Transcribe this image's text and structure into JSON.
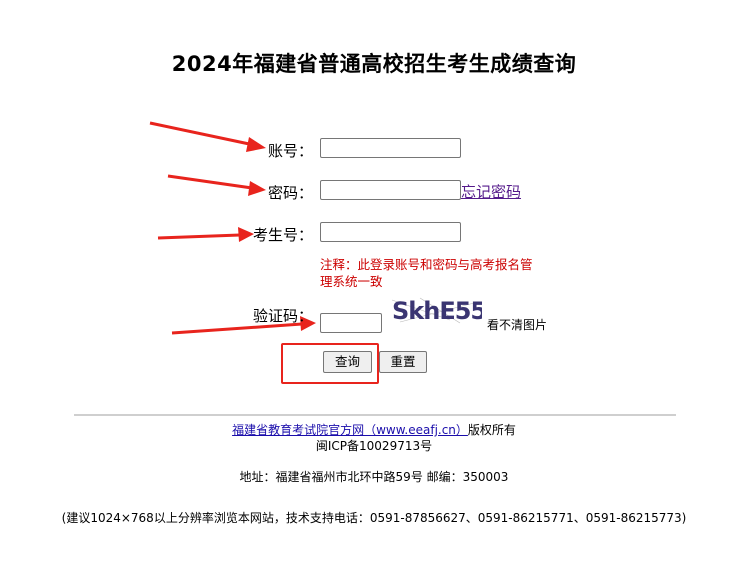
{
  "page": {
    "title": "2024年福建省普通高校招生考生成绩查询"
  },
  "form": {
    "account_label": "账号：",
    "account_value": "",
    "password_label": "密码：",
    "password_value": "",
    "forgot_link": "忘记密码",
    "exam_no_label": "考生号：",
    "exam_no_value": "",
    "note": "注释：此登录账号和密码与高考报名管理系统一致",
    "captcha_label": "验证码：",
    "captcha_value": "",
    "captcha_text": "SkhE55",
    "refresh_text": "看不清图片",
    "query_button": "查询",
    "reset_button": "重置"
  },
  "footer": {
    "site_link": "福建省教育考试院官方网（www.eeafj.cn）",
    "copyright": "版权所有",
    "icp": "闽ICP备10029713号",
    "address": "地址：福建省福州市北环中路59号 邮编：350003",
    "advice": "(建议1024×768以上分辨率浏览本网站，技术支持电话：0591-87856627、0591-86215771、0591-86215773)"
  },
  "colors": {
    "annotation_red": "#e8241d",
    "note_red": "#cc0000",
    "link_purple": "#551a8b"
  },
  "icons": {
    "annotation_arrow": "red-arrow-icon"
  }
}
